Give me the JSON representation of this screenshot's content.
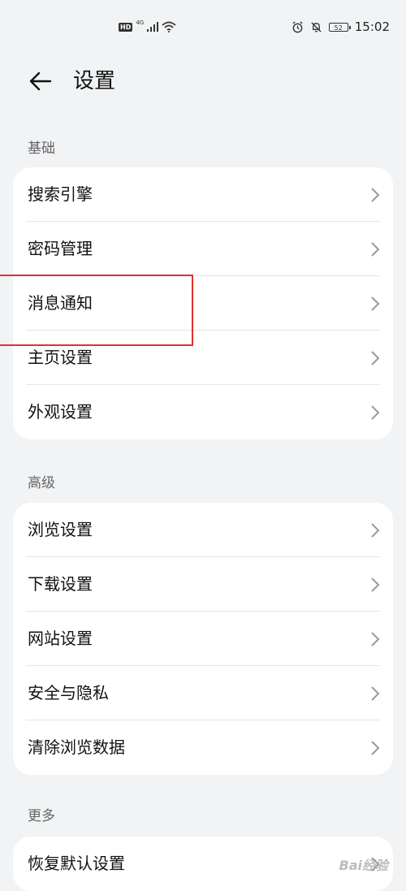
{
  "status": {
    "hd": "HD",
    "network": "4G",
    "battery": "52",
    "time": "15:02"
  },
  "header": {
    "title": "设置"
  },
  "sections": [
    {
      "label": "基础",
      "items": [
        "搜索引擎",
        "密码管理",
        "消息通知",
        "主页设置",
        "外观设置"
      ]
    },
    {
      "label": "高级",
      "items": [
        "浏览设置",
        "下载设置",
        "网站设置",
        "安全与隐私",
        "清除浏览数据"
      ]
    },
    {
      "label": "更多",
      "items": [
        "恢复默认设置"
      ]
    }
  ],
  "watermark": "Bai经验",
  "colors": {
    "background": "#f1f3f5",
    "card": "#ffffff",
    "highlight": "#e0322c"
  }
}
